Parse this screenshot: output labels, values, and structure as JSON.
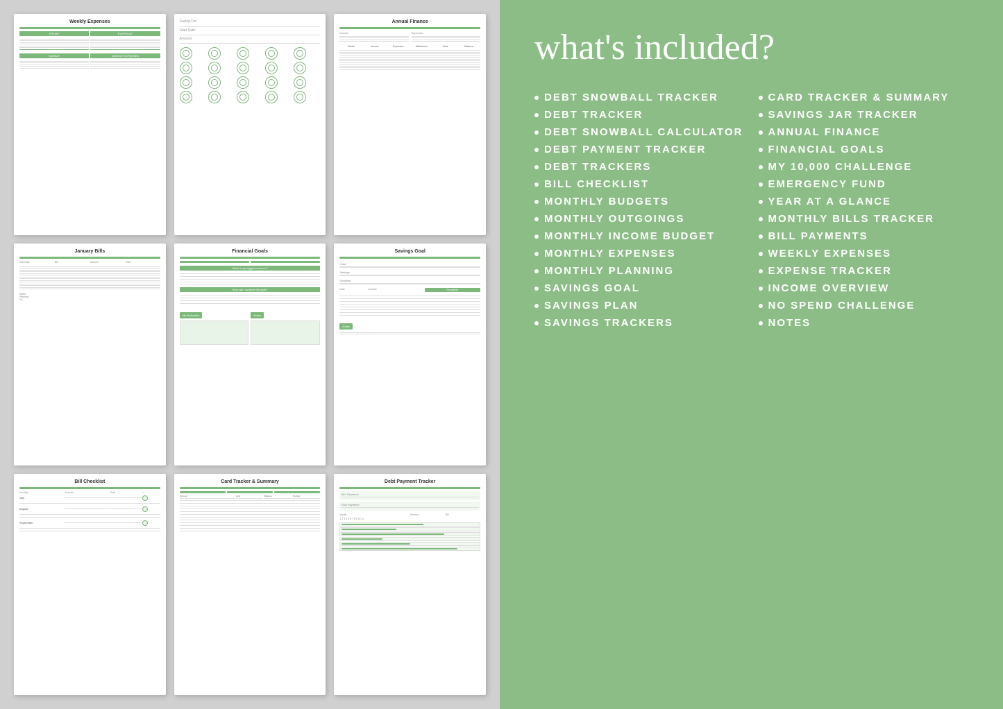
{
  "right_panel": {
    "title": "what's included?",
    "items": [
      "DEBT SNOWBALL TRACKER",
      "DEBT TRACKER",
      "DEBT SNOWBALL CALCULATOR",
      "DEBT PAYMENT TRACKER",
      "DEBT TRACKERS",
      "BILL CHECKLIST",
      "MONTHLY BUDGETS",
      "MONTHLY OUTGOINGS",
      "MONTHLY INCOME BUDGET",
      "MONTHLY EXPENSES",
      "MONTHLY PLANNING",
      "SAVINGS GOAL",
      "SAVINGS PLAN",
      "SAVINGS TRACKERS",
      "CARD TRACKER & SUMMARY",
      "SAVINGS JAR TRACKER",
      "ANNUAL FINANCE",
      "FINANCIAL GOALS",
      "MY 10,000 CHALLENGE",
      "EMERGENCY FUND",
      "YEAR AT A GLANCE",
      "MONTHLY BILLS TRACKER",
      "BILL PAYMENTS",
      "WEEKLY EXPENSES",
      "EXPENSE TRACKER",
      "INCOME OVERVIEW",
      "NO SPEND CHALLENGE",
      "NOTES"
    ]
  },
  "docs": {
    "weekly_expenses": "Weekly Expenses",
    "savings_jar": "Savings Jar Tracker",
    "annual_finance": "Annual Finance",
    "january_bills": "January Bills",
    "financial_goals": "Financial Goals",
    "savings_goal": "Savings Goal",
    "bill_checklist": "Bill Checklist",
    "card_tracker": "Card Tracker & Summary",
    "debt_payment": "Debt Payment Tracker"
  }
}
